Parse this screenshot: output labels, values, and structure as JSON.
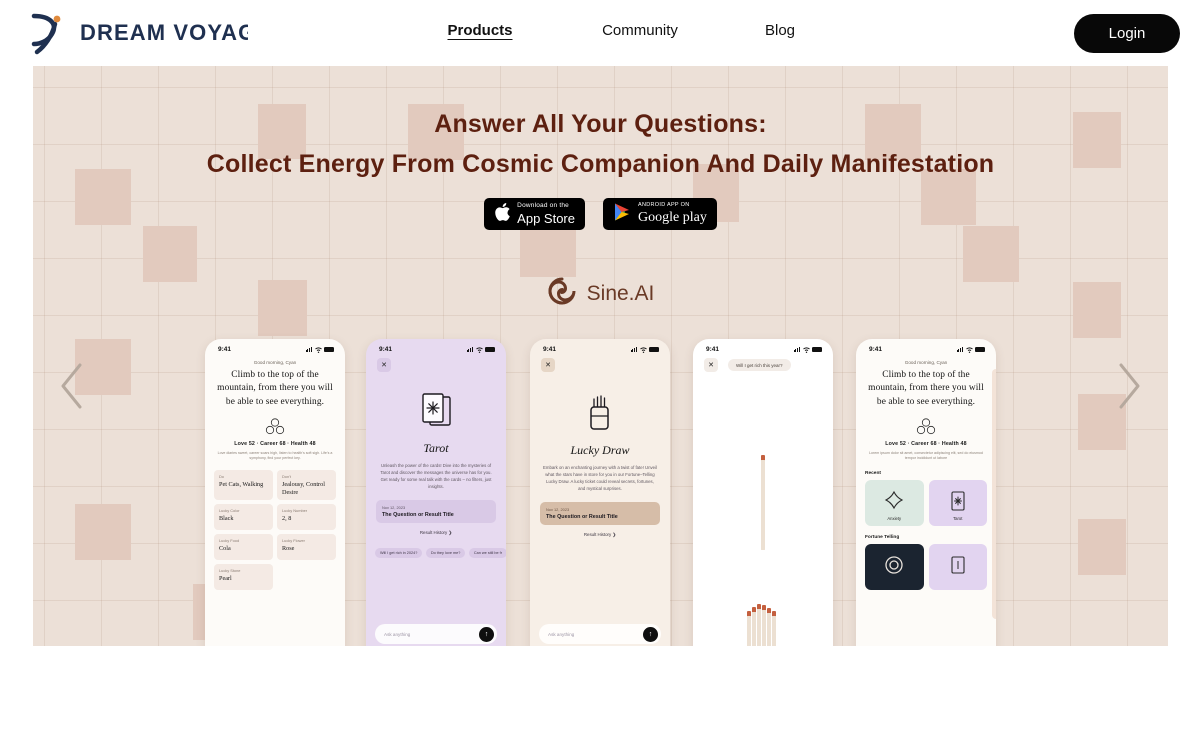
{
  "header": {
    "logo_text": "DREAM VOYAG",
    "logo_icon": "swoosh-logo-icon",
    "nav": [
      {
        "label": "Products",
        "active": true
      },
      {
        "label": "Community",
        "active": false
      },
      {
        "label": "Blog",
        "active": false
      }
    ],
    "login_label": "Login"
  },
  "hero": {
    "title_line1": "Answer All Your Questions:",
    "title_line2": "Collect Energy From Cosmic Companion And Daily Manifestation",
    "title_color": "#5d2010",
    "background_color": "#ece0d7",
    "square_color": "#e2cabe",
    "badges": [
      {
        "small": "Download on the",
        "big": "App Store",
        "icon": "apple-icon"
      },
      {
        "small": "ANDROID APP ON",
        "big": "Google play",
        "icon": "google-play-icon"
      }
    ],
    "brand": {
      "name": "Sine.AI",
      "icon": "spiral-logo-icon",
      "color": "#6a3a26"
    }
  },
  "carousel": {
    "prev_icon": "chevron-left-icon",
    "next_icon": "chevron-right-icon",
    "phones": [
      {
        "id": "daily-fortune",
        "status_time": "9:41",
        "greeting": "Good morning, Cyan",
        "quote": "Climb to the top of the mountain, from there you will be able to see everything.",
        "stats": "Love 52 · Career 68 · Health 48",
        "sub_text": "Love diaries sweet, career soars high, listen to health's soft sigh. Life's a symphony, find your perfect key.",
        "cards": [
          {
            "key": "Do",
            "value": "Pet Cats, Walking"
          },
          {
            "key": "Don't",
            "value": "Jealousy, Control Desire"
          },
          {
            "key": "Lucky Color",
            "value": "Black"
          },
          {
            "key": "Lucky Number",
            "value": "2, 8"
          },
          {
            "key": "Lucky Food",
            "value": "Cola"
          },
          {
            "key": "Lucky Flower",
            "value": "Rose"
          },
          {
            "key": "Lucky Stone",
            "value": "Pearl"
          }
        ]
      },
      {
        "id": "tarot",
        "status_time": "9:41",
        "close_icon": "close-icon",
        "icon": "tarot-cards-icon",
        "title": "Tarot",
        "description": "Unleash the power of the cards! Dive into the mysteries of Tarot and discover the messages the universe has for you. Get ready for some real talk with the cards – no filters, just insights.",
        "result_date": "Nov 12, 2023",
        "result_title": "The Question or Result Title",
        "result_history": "Result History ❯",
        "chips": [
          "Will I get rich in 2024?",
          "Do they love me?",
          "Can we still be fr"
        ],
        "input_placeholder": "Ask anything",
        "send_icon": "arrow-up-icon"
      },
      {
        "id": "lucky-draw",
        "status_time": "9:41",
        "close_icon": "close-icon",
        "icon": "fortune-sticks-icon",
        "title": "Lucky Draw",
        "description": "Embark on an enchanting journey with a twist of fate! Unveil what the stars have in store for you in our Fortune–Telling Lucky Draw. A lucky ticket could reveal secrets, fortunes, and mystical surprises.",
        "result_date": "Nov 12, 2023",
        "result_title": "The Question or Result Title",
        "result_history": "Result History ❯",
        "input_placeholder": "Ask anything",
        "send_icon": "arrow-up-icon"
      },
      {
        "id": "draw-animation",
        "status_time": "9:41",
        "close_icon": "close-icon",
        "question": "Will I get rich this year?",
        "stick_color": "#ece0d2",
        "stick_head_color": "#c4603f"
      },
      {
        "id": "home",
        "status_time": "9:41",
        "greeting": "Good morning, Cyan",
        "quote": "Climb to the top of the mountain, from there you will be able to see everything.",
        "stats": "Love 52 · Career 68 · Health 48",
        "sub_text": "Lorem ipsum dolor sit amet, consectetur adipiscing elit, sed do eiusmod tempor incididunt ut labore",
        "section_recent": "Recent",
        "recent_tiles": [
          {
            "label": "Anxiety",
            "icon": "star-knot-icon"
          },
          {
            "label": "Tarot",
            "icon": "tarot-card-icon"
          }
        ],
        "section_fortune": "Fortune Telling",
        "fortune_tiles": [
          {
            "label": "",
            "icon": "spiral-icon"
          },
          {
            "label": "",
            "icon": "card-icon"
          }
        ]
      }
    ]
  }
}
